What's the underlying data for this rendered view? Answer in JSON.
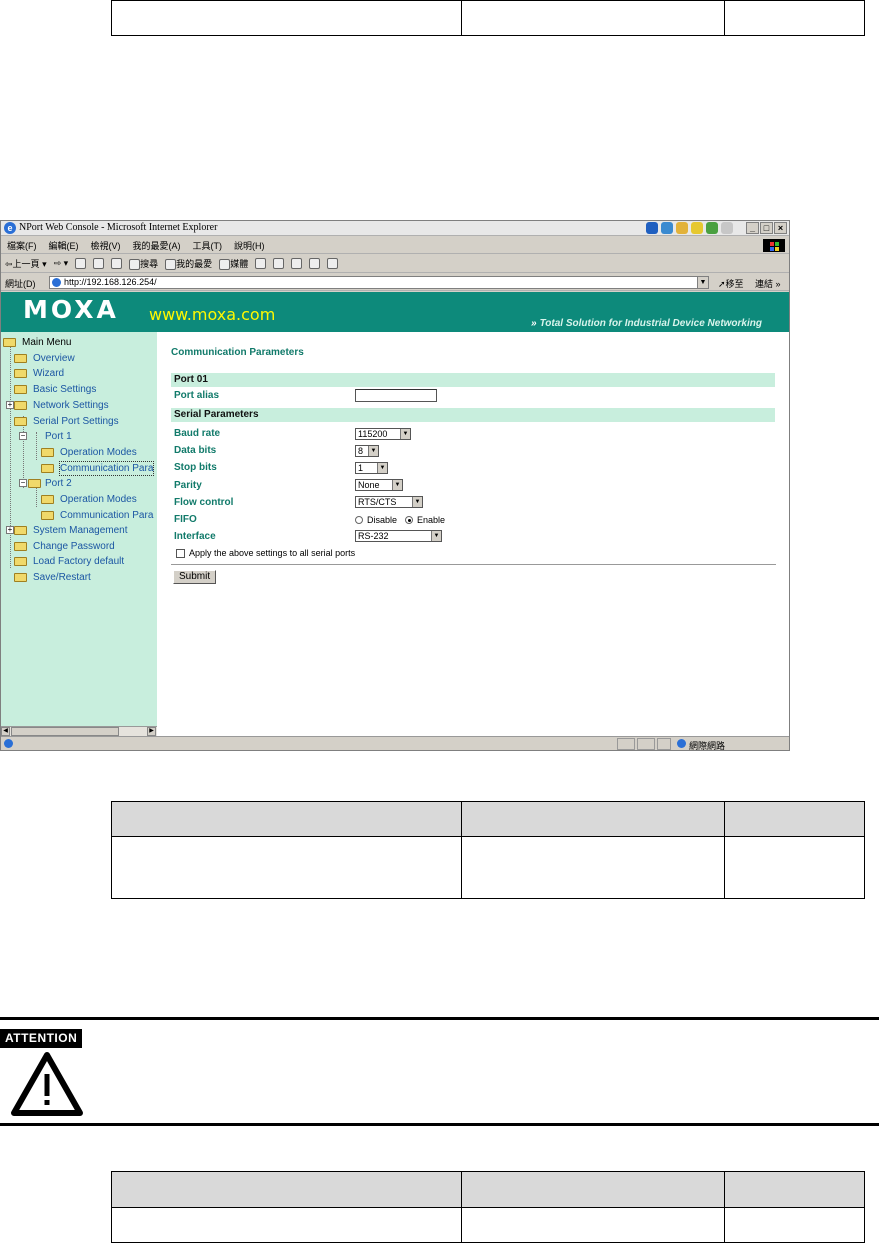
{
  "browser": {
    "title": "NPort Web Console - Microsoft Internet Explorer",
    "menu": [
      "檔案(F)",
      "編輯(E)",
      "檢視(V)",
      "我的最愛(A)",
      "工具(T)",
      "說明(H)"
    ],
    "toolbar": {
      "back": "上一頁",
      "search": "搜尋",
      "favorites": "我的最愛",
      "media": "媒體"
    },
    "address_label": "網址(D)",
    "address": "http://192.168.126.254/",
    "go": "移至",
    "links": "連結",
    "status_zone": "網際網路"
  },
  "banner": {
    "logo": "MOXA",
    "url": "www.moxa.com",
    "tagline": "Total Solution for Industrial Device Networking"
  },
  "tree": {
    "main_menu": "Main Menu",
    "overview": "Overview",
    "wizard": "Wizard",
    "basic_settings": "Basic Settings",
    "network_settings": "Network Settings",
    "serial_port_settings": "Serial Port Settings",
    "port1": "Port 1",
    "port1_operation_modes": "Operation Modes",
    "port1_communication": "Communication Para",
    "port2": "Port 2",
    "port2_operation_modes": "Operation Modes",
    "port2_communication": "Communication Para",
    "system_management": "System Management",
    "change_password": "Change Password",
    "load_factory_default": "Load Factory default",
    "save_restart": "Save/Restart"
  },
  "form": {
    "title": "Communication Parameters",
    "port_section": "Port 01",
    "port_alias_label": "Port alias",
    "port_alias_value": "",
    "serial_section": "Serial Parameters",
    "baud_rate_label": "Baud rate",
    "baud_rate_value": "115200",
    "data_bits_label": "Data bits",
    "data_bits_value": "8",
    "stop_bits_label": "Stop bits",
    "stop_bits_value": "1",
    "parity_label": "Parity",
    "parity_value": "None",
    "flow_control_label": "Flow control",
    "flow_control_value": "RTS/CTS",
    "fifo_label": "FIFO",
    "fifo_disable": "Disable",
    "fifo_enable": "Enable",
    "fifo_selected": "Enable",
    "interface_label": "Interface",
    "interface_value": "RS-232",
    "apply_all_label": "Apply the above settings to all serial ports",
    "apply_all_checked": false,
    "submit": "Submit"
  },
  "attention": {
    "badge": "ATTENTION"
  },
  "colors": {
    "banner": "#0d8a7b",
    "banner_url": "#fff900",
    "tree_bg": "#c8eedd",
    "label_green": "#117a6a",
    "tree_text": "#1b56a3"
  }
}
